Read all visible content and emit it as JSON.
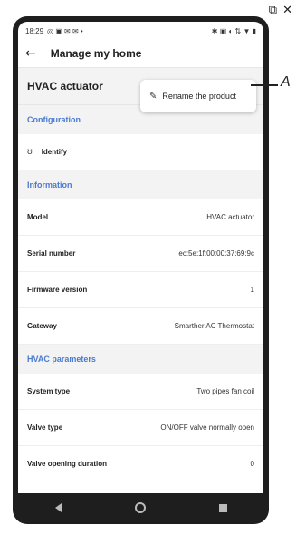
{
  "window": {
    "maximize_icon": "restore-icon",
    "close_icon": "close-icon"
  },
  "status_bar": {
    "time": "18:29"
  },
  "app_bar": {
    "back_glyph": "←",
    "title": "Manage my home"
  },
  "product": {
    "name": "HVAC actuator"
  },
  "popup": {
    "label": "Rename the product"
  },
  "annotation": {
    "label": "A"
  },
  "sections": {
    "configuration": "Configuration",
    "information": "Information",
    "hvac": "HVAC parameters"
  },
  "configuration": {
    "identify": "Identify"
  },
  "information": [
    {
      "label": "Model",
      "value": "HVAC actuator"
    },
    {
      "label": "Serial number",
      "value": "ec:5e:1f:00:00:37:69:9c"
    },
    {
      "label": "Firmware version",
      "value": "1"
    },
    {
      "label": "Gateway",
      "value": "Smarther AC Thermostat"
    }
  ],
  "hvac": [
    {
      "label": "System type",
      "value": "Two pipes fan coil"
    },
    {
      "label": "Valve type",
      "value": "ON/OFF valve normally open"
    },
    {
      "label": "Valve opening duration",
      "value": "0"
    }
  ],
  "colors": {
    "accent": "#4b7bd0",
    "section_bg": "#f3f3f3",
    "phone_frame": "#1e1e1e"
  }
}
